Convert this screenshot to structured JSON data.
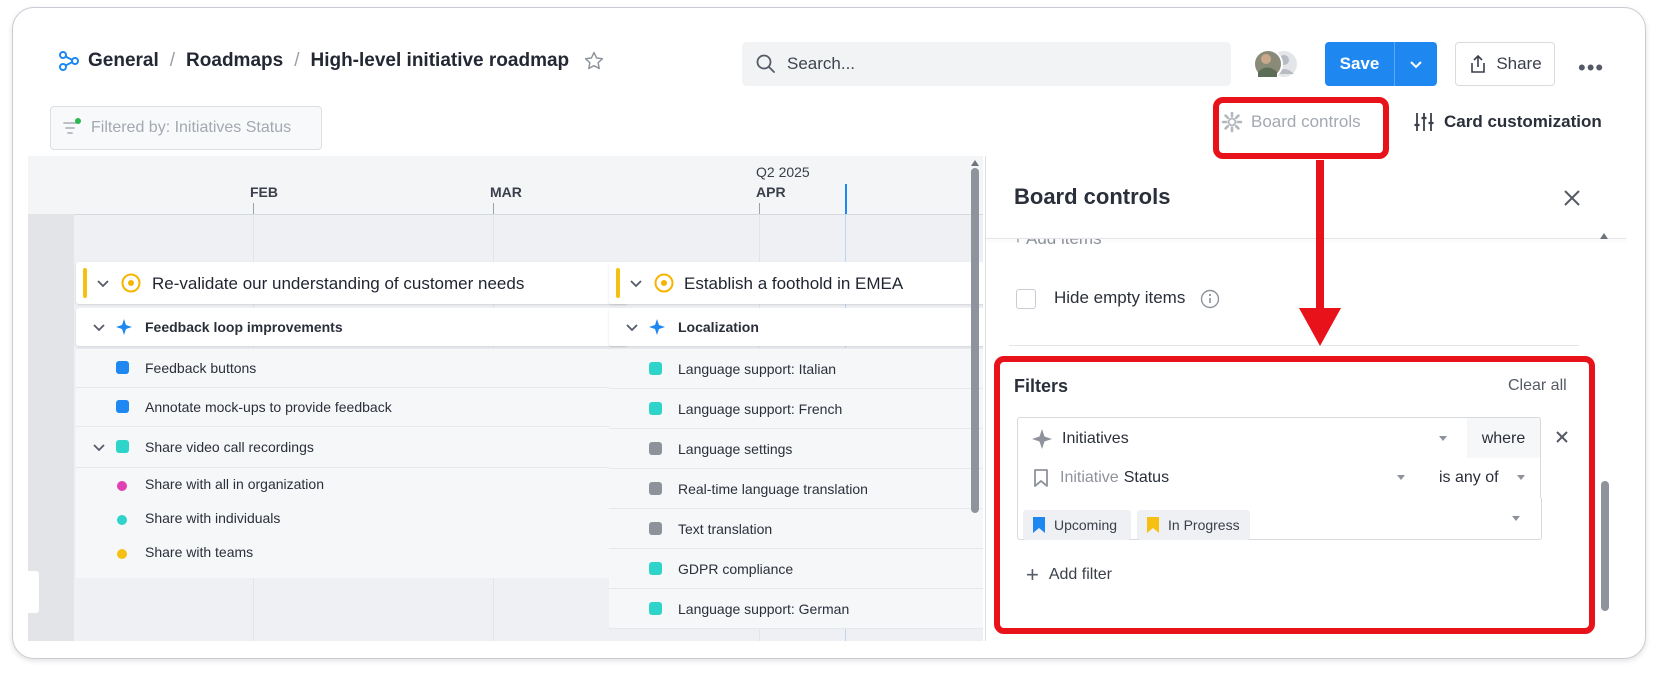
{
  "breadcrumb": {
    "items": [
      "General",
      "Roadmaps",
      "High-level initiative roadmap"
    ],
    "separator": "/"
  },
  "search": {
    "placeholder": "Search..."
  },
  "toolbar": {
    "save_label": "Save",
    "share_label": "Share",
    "more_label": "•••"
  },
  "filter_indicator": {
    "label": "Filtered by: Initiatives Status"
  },
  "view_controls": {
    "board_controls": "Board controls",
    "card_customization": "Card customization"
  },
  "timeline": {
    "quarter_label": "Q2 2025",
    "months": [
      "FEB",
      "MAR",
      "APR"
    ],
    "columns": [
      {
        "initiative": "Re-validate our understanding of customer needs",
        "groups": [
          {
            "name": "Feedback loop improvements",
            "items": [
              {
                "label": "Feedback buttons",
                "color": "#1e88f0"
              },
              {
                "label": "Annotate mock-ups to provide feedback",
                "color": "#1e88f0"
              }
            ]
          },
          {
            "name": "Share video call recordings",
            "color": "#2ed3c9",
            "items": [
              {
                "label": "Share with all in organization",
                "color": "#e23fb4"
              },
              {
                "label": "Share with individuals",
                "color": "#2ed3c9"
              },
              {
                "label": "Share with teams",
                "color": "#f6c012"
              }
            ]
          }
        ]
      },
      {
        "initiative": "Establish a foothold in EMEA",
        "groups": [
          {
            "name": "Localization",
            "items": [
              {
                "label": "Language support: Italian",
                "color": "#2ed3c9"
              },
              {
                "label": "Language support: French",
                "color": "#2ed3c9"
              },
              {
                "label": "Language settings",
                "color": "#8e939b"
              },
              {
                "label": "Real-time language translation",
                "color": "#8e939b"
              },
              {
                "label": "Text translation",
                "color": "#8e939b"
              },
              {
                "label": "GDPR compliance",
                "color": "#2ed3c9"
              },
              {
                "label": "Language support: German",
                "color": "#2ed3c9"
              }
            ]
          }
        ]
      }
    ]
  },
  "board_controls": {
    "title": "Board controls",
    "add_items_label": "Add items",
    "hide_empty_label": "Hide empty items",
    "hide_empty_checked": false,
    "filters": {
      "heading": "Filters",
      "clear_all": "Clear all",
      "entity": "Initiatives",
      "where": "where",
      "field_prefix": "Initiative",
      "field_name": "Status",
      "operator": "is any of",
      "values": [
        {
          "label": "Upcoming",
          "color": "#1e88f0"
        },
        {
          "label": "In Progress",
          "color": "#f6c012"
        }
      ],
      "add_filter": "Add filter"
    }
  },
  "colors": {
    "accent": "#1e88f0",
    "highlight": "#e8121b",
    "initiative_bar": "#f6c012"
  }
}
